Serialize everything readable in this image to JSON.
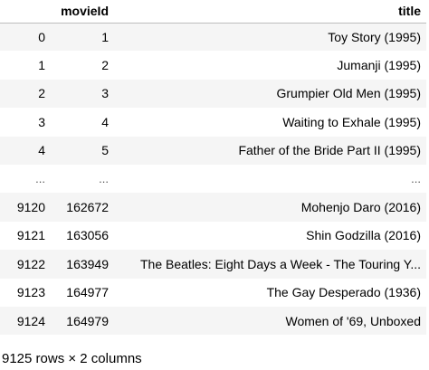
{
  "table": {
    "headers": [
      "",
      "movieId",
      "title"
    ],
    "rows": [
      [
        "0",
        "1",
        "Toy Story (1995)"
      ],
      [
        "1",
        "2",
        "Jumanji (1995)"
      ],
      [
        "2",
        "3",
        "Grumpier Old Men (1995)"
      ],
      [
        "3",
        "4",
        "Waiting to Exhale (1995)"
      ],
      [
        "4",
        "5",
        "Father of the Bride Part II (1995)"
      ],
      [
        "...",
        "...",
        "..."
      ],
      [
        "9120",
        "162672",
        "Mohenjo Daro (2016)"
      ],
      [
        "9121",
        "163056",
        "Shin Godzilla (2016)"
      ],
      [
        "9122",
        "163949",
        "The Beatles: Eight Days a Week - The Touring Y..."
      ],
      [
        "9123",
        "164977",
        "The Gay Desperado (1936)"
      ],
      [
        "9124",
        "164979",
        "Women of '69, Unboxed"
      ]
    ]
  },
  "summary": "9125 rows × 2 columns"
}
